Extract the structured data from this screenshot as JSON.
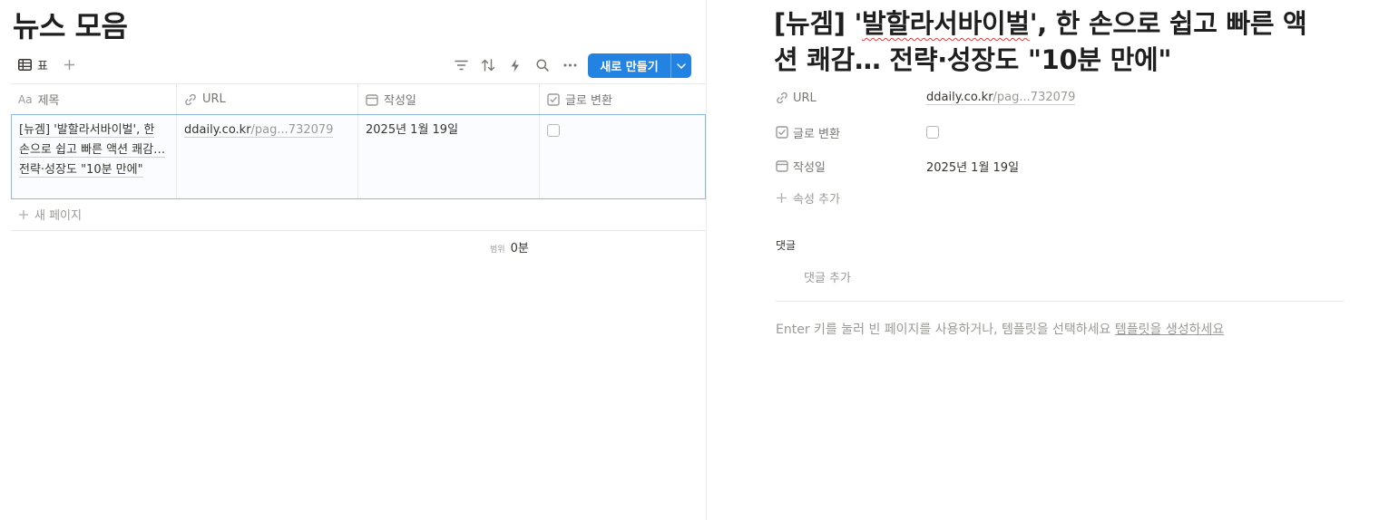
{
  "database": {
    "title": "뉴스 모음",
    "view_tab_label": "표",
    "new_button_label": "새로 만들기",
    "columns": {
      "title": {
        "icon_text": "Aa",
        "label": "제목"
      },
      "url": {
        "label": "URL"
      },
      "date": {
        "label": "작성일"
      },
      "converted": {
        "label": "글로 변환"
      }
    },
    "rows": [
      {
        "title": "[뉴겜] '발할라서바이벌', 한 손으로 쉽고 빠른 액션 쾌감… 전략·성장도 \"10분 만에\"",
        "url_host": "ddaily.co.kr",
        "url_rest": "/pag...732079",
        "date": "2025년 1월 19일",
        "converted": false
      }
    ],
    "new_page_label": "새 페이지",
    "calc_label": "범위",
    "calc_value": "0분"
  },
  "peek": {
    "title_prefix": "[뉴겜] '",
    "title_spell": "발할라서바이벌",
    "title_suffix": "', 한 손으로 쉽고 빠른 액션 쾌감… 전략·성장도 \"10분 만에\"",
    "properties": {
      "url": {
        "label": "URL",
        "host": "ddaily.co.kr",
        "rest": "/pag...732079"
      },
      "converted": {
        "label": "글로 변환",
        "checked": false
      },
      "date": {
        "label": "작성일",
        "value": "2025년 1월 19일"
      }
    },
    "add_property_label": "속성 추가",
    "comments_label": "댓글",
    "add_comment_placeholder": "댓글 추가",
    "hint_text": "Enter 키를 눌러 빈 페이지를 사용하거나, 템플릿을 선택하세요 ",
    "hint_link": "템플릿을 생성하세요"
  },
  "colors": {
    "accent": "#2383e2",
    "text": "#37352f",
    "muted": "#9b9a97"
  }
}
